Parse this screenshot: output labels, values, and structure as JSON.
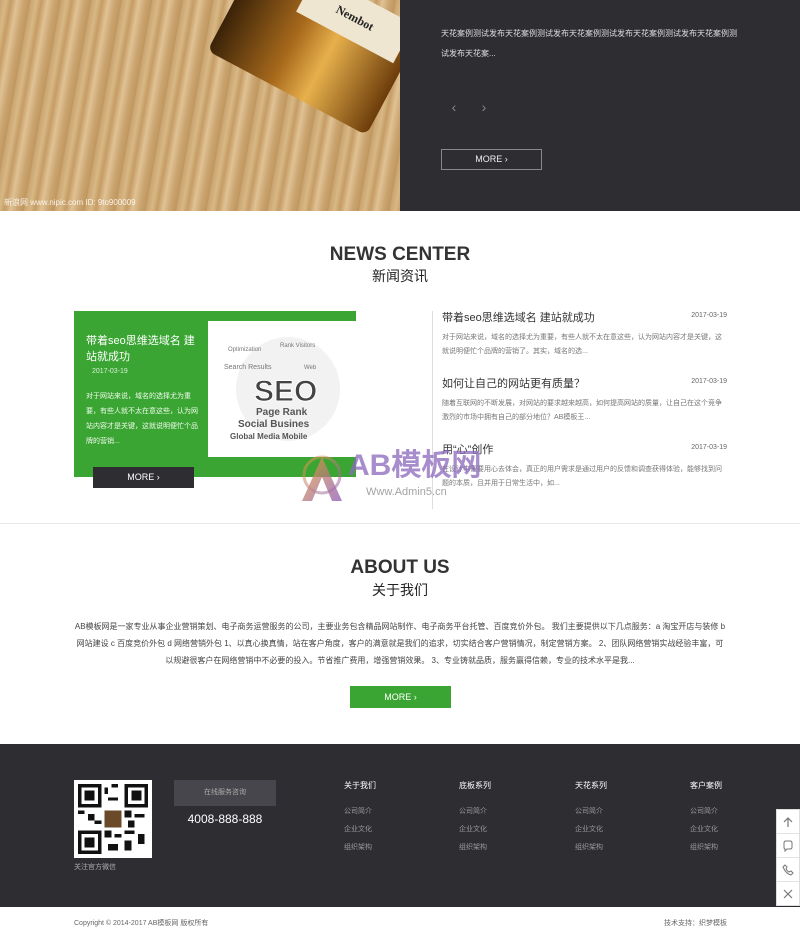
{
  "hero": {
    "image_watermark": "新浪网 www.nipic.com   ID: 9to900009",
    "bottle_label": "Nembot",
    "description": "天花案例测试发布天花案例测试发布天花案例测试发布天花案例测试发布天花案例测试发布天花案...",
    "prev": "‹",
    "next": "›",
    "more": "MORE"
  },
  "news": {
    "title": "NEWS CENTER",
    "subtitle": "新闻资讯",
    "featured": {
      "title": "带着seo思维选域名 建站就成功",
      "date": "2017-03-19",
      "summary": "对于网站来说，域名的选择尤为重要，有些人就不太在意这些，认为网站内容才是关键，这就说明便忙个品牌的营销..."
    },
    "more": "MORE",
    "items": [
      {
        "title": "带着seo思维选域名 建站就成功",
        "date": "2017-03-19",
        "summary": "对于网站来说，域名的选择尤为重要，有些人就不太在意这些，认为网站内容才是关键，这就说明便忙个品牌的营销了。其实，域名的选..."
      },
      {
        "title": "如何让自己的网站更有质量？",
        "date": "2017-03-19",
        "summary": "随着互联网的不断发展，对网站的要求越来越高，如何提高网站的质量，让自己在这个竞争激烈的市场中拥有自己的部分地位？AB模板王..."
      },
      {
        "title": "用“心”创作",
        "date": "2017-03-19",
        "summary": "在设计中需要用心去体会，真正的用户需求是通过用户的反馈和调查获得体验，能够找到问题的本质，且并用于日常生活中，如..."
      }
    ]
  },
  "watermark": {
    "brand": "AB模板网",
    "url": "Www.Admin5.cn"
  },
  "about": {
    "title": "ABOUT US",
    "subtitle": "关于我们",
    "text": "AB模板网是一家专业从事企业营销策划、电子商务运营服务的公司，主要业务包含精品网站制作、电子商务平台托管、百度竞价外包。 我们主要提供以下几点服务：a 淘宝开店与装修 b 网站建设 c 百度竞价外包 d 网络营销外包 1、以真心换真情，站在客户角度，客户的满意就是我们的追求，切实结合客户营销情况，制定营销方案。 2、团队网络营销实战经验丰富，可以规避很客户在网络营销中不必要的投入。节省推广费用，增强营销效果。 3、专业铸就品质，服务赢得信赖，专业的技术水平是我...",
    "more": "MORE"
  },
  "footer": {
    "qr_caption": "关注官方微信",
    "service_button": "在线服务咨询",
    "phone": "4008-888-888",
    "columns": [
      {
        "heading": "关于我们",
        "links": [
          "公司简介",
          "企业文化",
          "组织架构"
        ]
      },
      {
        "heading": "底板系列",
        "links": [
          "公司简介",
          "企业文化",
          "组织架构"
        ]
      },
      {
        "heading": "天花系列",
        "links": [
          "公司简介",
          "企业文化",
          "组织架构"
        ]
      },
      {
        "heading": "客户案例",
        "links": [
          "公司简介",
          "企业文化",
          "组织架构"
        ]
      }
    ],
    "copyright": "Copyright © 2014-2017 AB模板网 版权所有",
    "support": "技术支持：织梦模板"
  },
  "side_icons": [
    "arrow-up-icon",
    "chat-icon",
    "phone-icon",
    "close-icon"
  ],
  "colors": {
    "accent": "#3aa532",
    "dark": "#2e2d32"
  }
}
